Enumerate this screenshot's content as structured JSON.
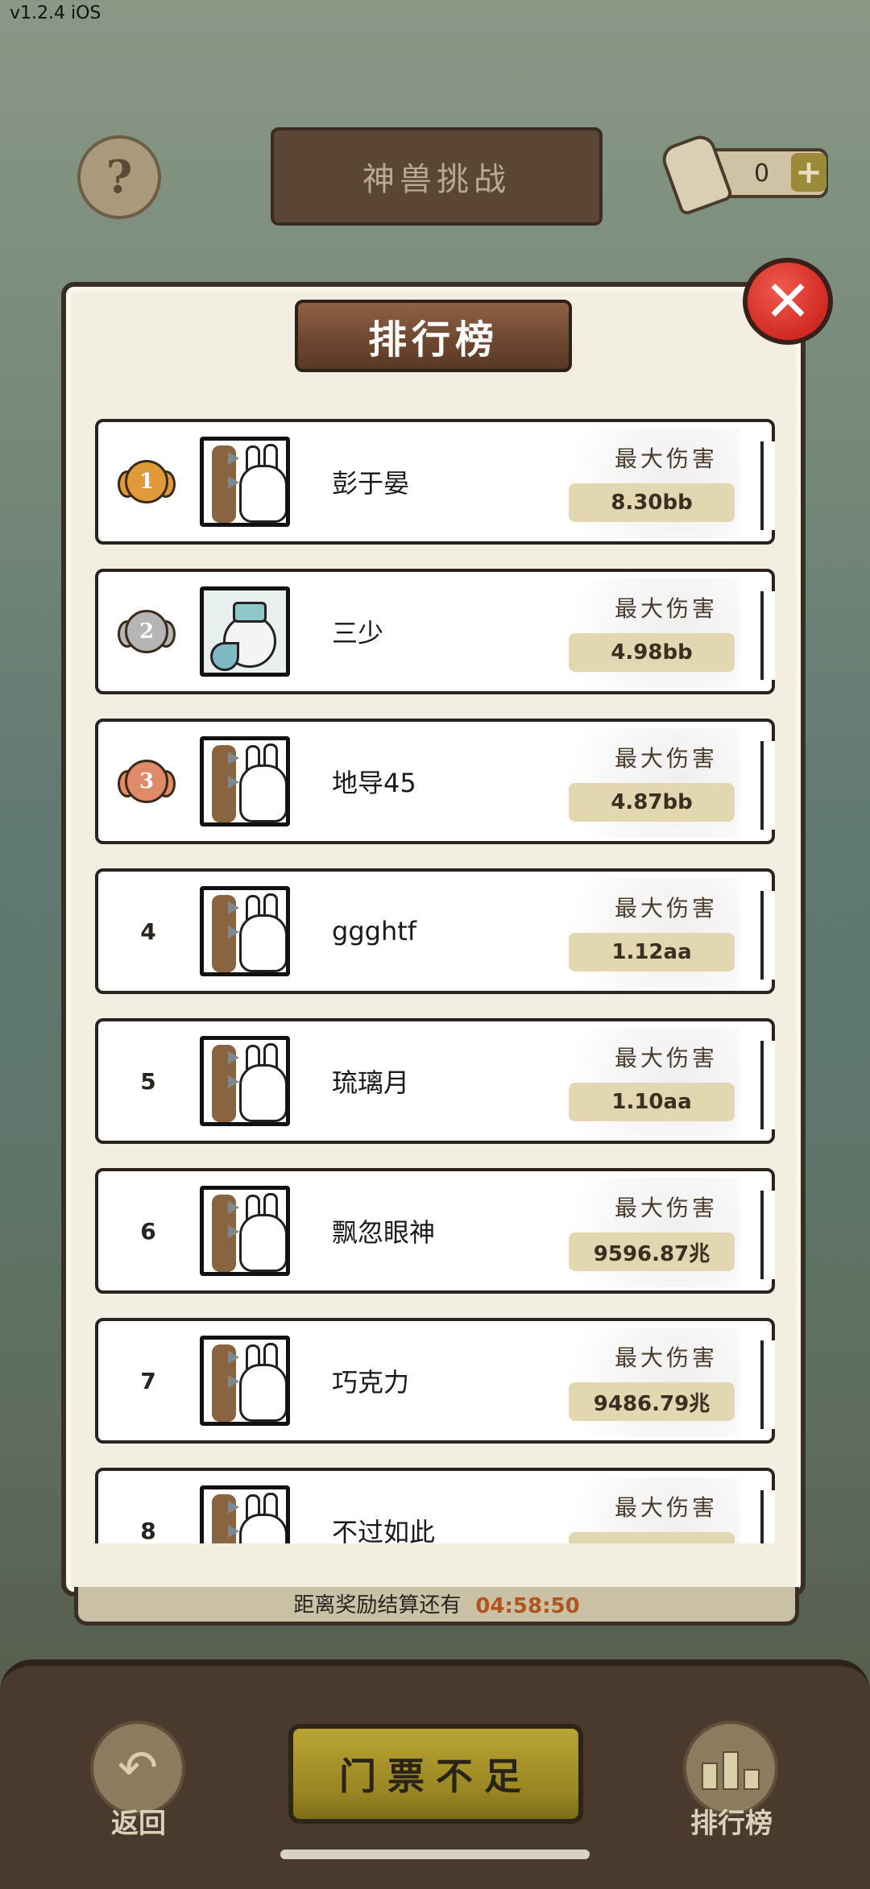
{
  "app": {
    "version": "v1.2.4 iOS"
  },
  "header": {
    "help_symbol": "?",
    "title": "神兽挑战",
    "ticket_count": "0",
    "plus_symbol": "+"
  },
  "panel": {
    "title": "排行榜",
    "close_symbol": "✕"
  },
  "ranking": {
    "rows": [
      {
        "rank": "1",
        "name": "彭于晏",
        "damage_label": "最大伤害",
        "damage": "8.30bb",
        "medal": "gold",
        "avatar": "bunny-club"
      },
      {
        "rank": "2",
        "name": "三少",
        "damage_label": "最大伤害",
        "damage": "4.98bb",
        "medal": "silver",
        "avatar": "scholar"
      },
      {
        "rank": "3",
        "name": "地导45",
        "damage_label": "最大伤害",
        "damage": "4.87bb",
        "medal": "bronze",
        "avatar": "bunny-club"
      },
      {
        "rank": "4",
        "name": "ggghtf",
        "damage_label": "最大伤害",
        "damage": "1.12aa",
        "medal": "",
        "avatar": "bunny-club"
      },
      {
        "rank": "5",
        "name": "琉璃月",
        "damage_label": "最大伤害",
        "damage": "1.10aa",
        "medal": "",
        "avatar": "bunny-club"
      },
      {
        "rank": "6",
        "name": "飘忽眼神",
        "damage_label": "最大伤害",
        "damage": "9596.87兆",
        "medal": "",
        "avatar": "bunny-club"
      },
      {
        "rank": "7",
        "name": "巧克力",
        "damage_label": "最大伤害",
        "damage": "9486.79兆",
        "medal": "",
        "avatar": "bunny-club"
      },
      {
        "rank": "8",
        "name": "不过如此",
        "damage_label": "最大伤害",
        "damage": "",
        "medal": "",
        "avatar": "bunny-club"
      }
    ]
  },
  "timer": {
    "label": "距离奖励结算还有",
    "time": "04:58:50"
  },
  "bottom": {
    "back_label": "返回",
    "back_symbol": "↶",
    "ticket_button": "门票不足",
    "rank_label": "排行榜"
  },
  "colors": {
    "medal_gold": "#e09a3a",
    "medal_silver": "#b5b5b5",
    "medal_bronze": "#e08a6a",
    "damage_pill": "#e3d7b2",
    "close_red": "#d22a22"
  }
}
